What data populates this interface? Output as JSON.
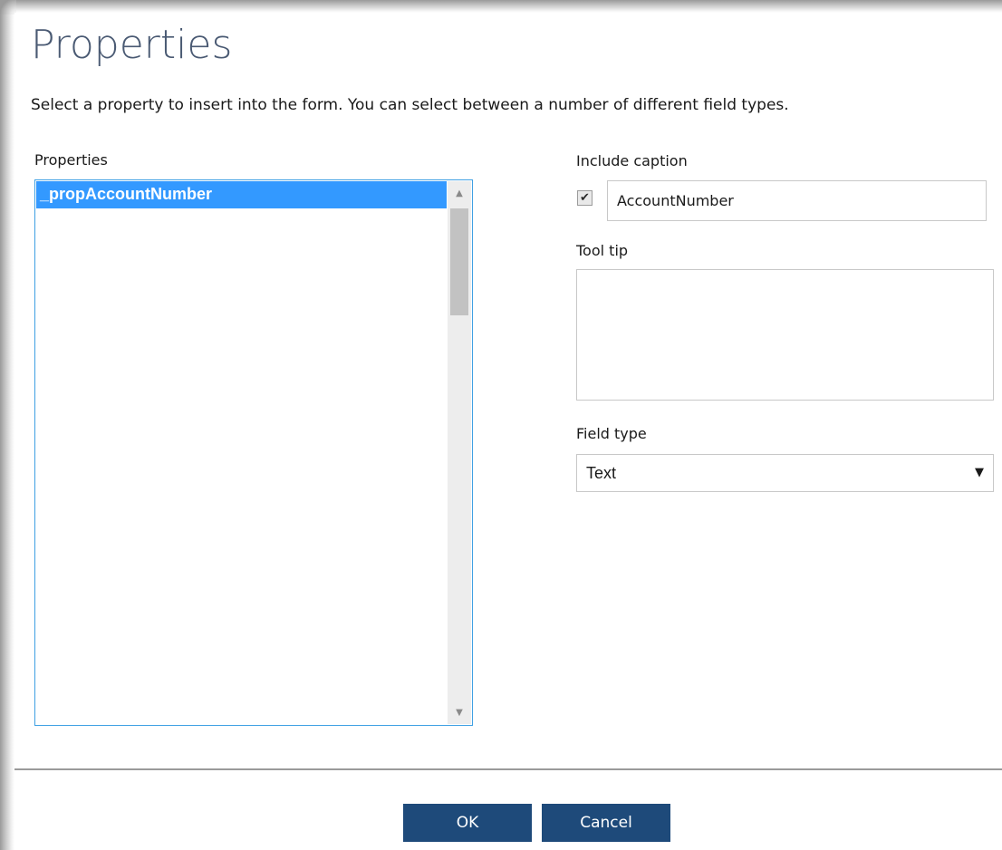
{
  "dialog": {
    "title": "Properties",
    "description": "Select a property to insert into the form. You can select between a number of different field types."
  },
  "properties_list": {
    "label": "Properties",
    "items": [
      "_propAccountNumber"
    ],
    "selected_index": 0
  },
  "caption": {
    "label": "Include caption",
    "checked": true,
    "check_glyph": "✔",
    "value": "AccountNumber"
  },
  "tooltip": {
    "label": "Tool tip",
    "value": ""
  },
  "field_type": {
    "label": "Field type",
    "selected": "Text",
    "arrow_glyph": "▼"
  },
  "scrollbar": {
    "up_glyph": "▲",
    "down_glyph": "▼"
  },
  "buttons": {
    "ok_label": "OK",
    "cancel_label": "Cancel"
  },
  "colors": {
    "title": "#4a5a73",
    "selection": "#3399ff",
    "list_border": "#3fa0e3",
    "button": "#1e4a7a"
  }
}
